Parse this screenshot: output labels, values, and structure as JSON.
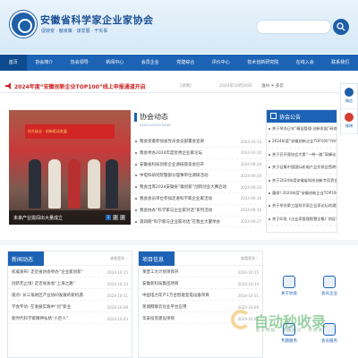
{
  "header": {
    "site_title": "安徽省科学家企业家协会",
    "slogan": "促转变 · 献良策 · 谋发展 · 干实事"
  },
  "nav": {
    "items": [
      "首页",
      "协会简介",
      "协会领导",
      "新闻中心",
      "会员企业",
      "党建综合",
      "评价中心",
      "技术创新研究院",
      "在线入会",
      "联系我们"
    ]
  },
  "notice": {
    "headline": "2024年度“安徽创新企业TOP100”线上申报通道开启",
    "tag": "[详情]",
    "date_text": "2024年10月20日",
    "weather_text": "淮州   ☀  多云"
  },
  "side": {
    "items": [
      "微信",
      "微博",
      "分享"
    ]
  },
  "slider": {
    "banner_text": "科大硅谷 · 创新驱动发展",
    "caption": "未来产业需闯出大量成立",
    "dots": [
      "1",
      "2",
      "3"
    ]
  },
  "association_news": {
    "title": "协会动态",
    "subtitle": "ASSOCIATION NEWS",
    "items": [
      {
        "title": "我会受邀参加省党员会议部署会宣讲",
        "date": "2024-10-14"
      },
      {
        "title": "我会举办2024年度优秀企业家论坛",
        "date": "2024-10-10"
      },
      {
        "title": "安徽省科技创新企业调研座谈会召开",
        "date": "2024-09-28"
      },
      {
        "title": "中电科研究院暨部分理事单位调研活动",
        "date": "2024-09-24"
      },
      {
        "title": "我会出席2024安徽省“徽创新”创新创业大赛启动",
        "date": "2024-09-20"
      },
      {
        "title": "我会会员单位参加走进科学家企业家活动",
        "date": "2024-09-16"
      },
      {
        "title": "我会协办“科学家与企业家对话”系列活动",
        "date": "2024-09-10"
      },
      {
        "title": "第四期“科学家与企业家对话”在我主大厦举办",
        "date": "2024-09-27"
      }
    ]
  },
  "association_notice": {
    "title": "协会公告",
    "items": [
      "关于举办日年“精益管理·创新发展”研修班的通知",
      "2024年度“安徽创新企业TOP100”评价公示",
      "关于召开我协会大第“一带一路”高峰论坛的通知",
      "关于征集中国国际机电产品交易会暨跨境贸易企业",
      "关于2024年度安徽省科技创新专项资金申报的通知",
      "重磅! 2024年度“安徽创新企业TOP100”评价公告",
      "关于举办第三届科学家企业家论坛的通知",
      "关于印发《企业家管理智慧全集》的征稿函"
    ]
  },
  "news_card": {
    "title": "新闻动态",
    "more": "查看更多 ›",
    "items": [
      {
        "title": "权威发布! 走近省协会举办“企业家创新”",
        "date": "2024-10-15"
      },
      {
        "title": "创新无止境! 走近省协会“上海之路”",
        "date": "2024-10-14"
      },
      {
        "title": "观点! 长三角地区产业协同发展的新机遇",
        "date": "2024-10-11"
      },
      {
        "title": "学会专访: 在发展实践中“创”新业",
        "date": "2024-10-08"
      },
      {
        "title": "新时代科学家精神弘扬“小巨人”",
        "date": "2024-10-03"
      }
    ]
  },
  "project_card": {
    "title": "项目信息",
    "more": "查看更多 ›",
    "items": [
      {
        "title": "莱普工大计划项目开",
        "date": "2024-10-15"
      },
      {
        "title": "安徽新科技集团项目",
        "date": "2024-10-14"
      },
      {
        "title": "中国电力年产1万台智能变电设备项目",
        "date": "2024-10-11"
      },
      {
        "title": "芜湖网联云化业平台应用",
        "date": "2024-10-09"
      },
      {
        "title": "华安投资建设项目",
        "date": "2024-10-07"
      }
    ]
  },
  "services": {
    "items": [
      "关于协会",
      "会员企业",
      "专题服务",
      "会员服务"
    ]
  },
  "watermark": {
    "brand": "自动秒收录",
    "tagline": "提交网站 · 审核通过 · 秒收录"
  }
}
